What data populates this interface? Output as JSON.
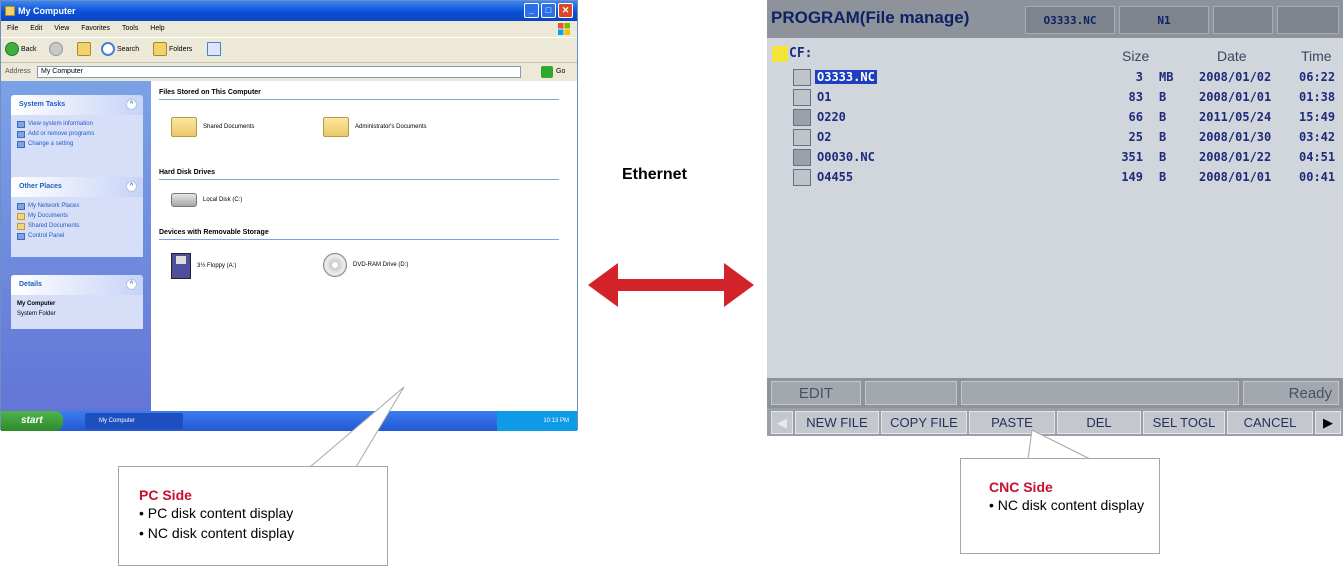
{
  "pc": {
    "title": "My Computer",
    "menu": [
      "File",
      "Edit",
      "View",
      "Favorites",
      "Tools",
      "Help"
    ],
    "toolbar": {
      "back": "Back",
      "search": "Search",
      "folders": "Folders"
    },
    "address": {
      "label": "Address",
      "value": "My Computer",
      "go": "Go"
    },
    "panels": {
      "system_tasks": {
        "title": "System Tasks",
        "items": [
          "View system information",
          "Add or remove programs",
          "Change a setting"
        ]
      },
      "other_places": {
        "title": "Other Places",
        "items": [
          "My Network Places",
          "My Documents",
          "Shared Documents",
          "Control Panel"
        ]
      },
      "details": {
        "title": "Details",
        "name": "My Computer",
        "sub": "System Folder"
      }
    },
    "groups": {
      "stored": "Files Stored on This Computer",
      "hdd": "Hard Disk Drives",
      "removable": "Devices with Removable Storage"
    },
    "items": {
      "shared_docs": "Shared Documents",
      "admin_docs": "Administrator's Documents",
      "local_disk": "Local Disk (C:)",
      "floppy": "3½ Floppy (A:)",
      "dvd": "DVD-RAM Drive (D:)"
    },
    "taskbar": {
      "start": "start",
      "task": "My Computer",
      "clock": "10:13 PM"
    }
  },
  "ethernet_label": "Ethernet",
  "cnc": {
    "title": "PROGRAM(File manage)",
    "current_file": "O3333.NC",
    "block": "N1",
    "drive": "CF:",
    "headers": {
      "size": "Size",
      "date": "Date",
      "time": "Time"
    },
    "files": [
      {
        "name": "O3333.NC",
        "size": "3",
        "unit": "MB",
        "date": "2008/01/02",
        "time": "06:22",
        "selected": true
      },
      {
        "name": "O1",
        "size": "83",
        "unit": "B",
        "date": "2008/01/01",
        "time": "01:38"
      },
      {
        "name": "O220",
        "size": "66",
        "unit": "B",
        "date": "2011/05/24",
        "time": "15:49"
      },
      {
        "name": "O2",
        "size": "25",
        "unit": "B",
        "date": "2008/01/30",
        "time": "03:42"
      },
      {
        "name": "O0030.NC",
        "size": "351",
        "unit": "B",
        "date": "2008/01/22",
        "time": "04:51"
      },
      {
        "name": "O4455",
        "size": "149",
        "unit": "B",
        "date": "2008/01/01",
        "time": "00:41"
      }
    ],
    "status": {
      "mode": "EDIT",
      "state": "Ready"
    },
    "softkeys": [
      "NEW FILE",
      "COPY FILE",
      "PASTE",
      "DEL",
      "SEL TOGL",
      "CANCEL"
    ]
  },
  "callouts": {
    "pc": {
      "title": "PC Side",
      "lines": [
        "• PC disk content display",
        "• NC disk content display"
      ]
    },
    "cnc": {
      "title": "CNC Side",
      "lines": [
        "• NC disk content display"
      ]
    }
  },
  "colors": {
    "arrow": "#d2232a",
    "callout_title": "#c8102e",
    "cnc_text": "#1f2b7a",
    "xp_blue": "#0b50d6"
  }
}
